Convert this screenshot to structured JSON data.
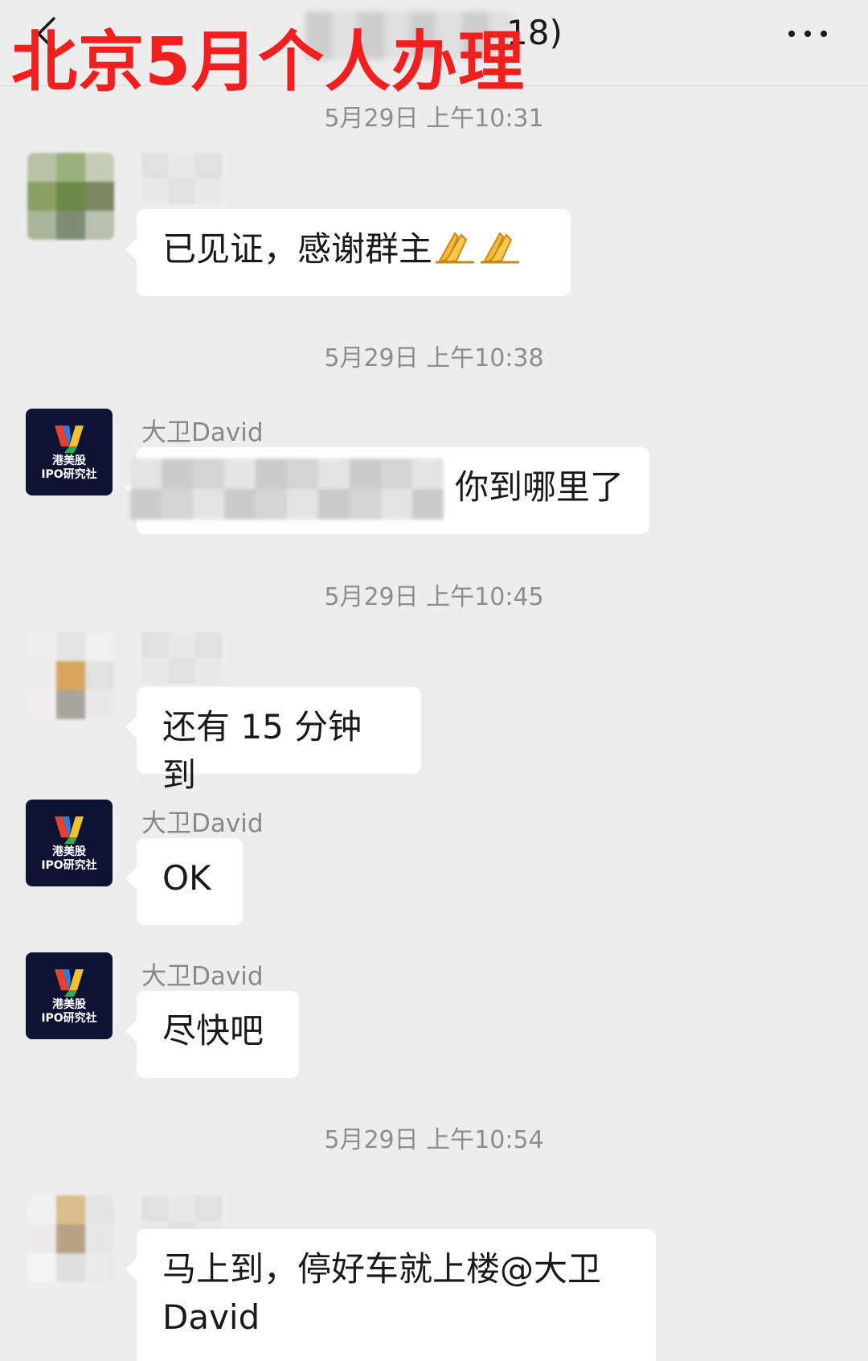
{
  "header": {
    "title_suffix": "18)",
    "overlay_text": "北京5月个人办理"
  },
  "messages": {
    "t1": "5月29日 上午10:31",
    "m1": "已见证，感谢群主",
    "t2": "5月29日 上午10:38",
    "m2_sender": "大卫David",
    "m2": "你到哪里了",
    "t3": "5月29日 上午10:45",
    "m3": "还有 15 分钟到",
    "m4_sender": "大卫David",
    "m4": "OK",
    "m5_sender": "大卫David",
    "m5": "尽快吧",
    "t4": "5月29日 上午10:54",
    "m6_line1": "马上到，停好车就上楼@大卫",
    "m6_line2": "David"
  },
  "logo": {
    "line1": "港美股",
    "line2": "IPO研究社"
  },
  "colors": {
    "background": "#ededed",
    "bubble": "#ffffff",
    "timestamp": "#8d8d8d",
    "overlay": "#f21f1f",
    "logo_bg": "#0e1233"
  }
}
